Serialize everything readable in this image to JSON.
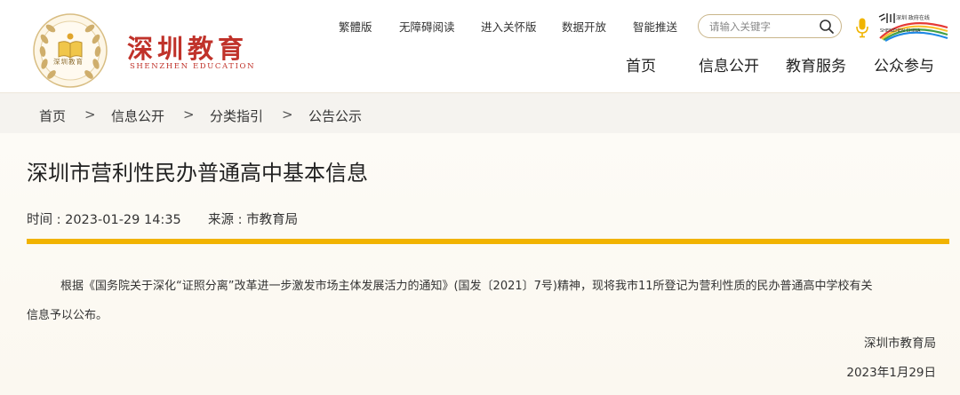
{
  "header": {
    "logo_title": "深圳教育",
    "logo_subtitle": "SHENZHEN EDUCATION",
    "logo_emblem_text": "深圳教育",
    "top_links": [
      "繁體版",
      "无障碍阅读",
      "进入关怀版",
      "数据开放",
      "智能推送"
    ],
    "search": {
      "placeholder": "请输入关键字",
      "value": ""
    },
    "sz_logo_text": "深圳 政府在线",
    "sz_logo_caption": "SHENZHEN CHINA",
    "main_nav": [
      "首页",
      "信息公开",
      "教育服务",
      "公众参与"
    ]
  },
  "breadcrumb": {
    "items": [
      "首页",
      "信息公开",
      "分类指引",
      "公告公示"
    ],
    "separator": ">"
  },
  "article": {
    "title": "深圳市营利性民办普通高中基本信息",
    "time_label": "时间 : 2023-01-29 14:35",
    "source_label": "来源 : 市教育局",
    "para_line1": "根据《国务院关于深化“证照分离”改革进一步激发市场主体发展活力的通知》(国发〔2021〕7号)精神，现将我市11所登记为营利性质的民办普通高中学校有关",
    "para_line2": "信息予以公布。",
    "signature": "深圳市教育局",
    "date": "2023年1月29日"
  },
  "colors": {
    "brand_red": "#c0322a",
    "gold_rule": "#f1b300",
    "emblem_gold": "#c9a558"
  },
  "icons": [
    "search-icon",
    "microphone-icon",
    "book-emblem-icon",
    "shenzhen-government-logo"
  ]
}
